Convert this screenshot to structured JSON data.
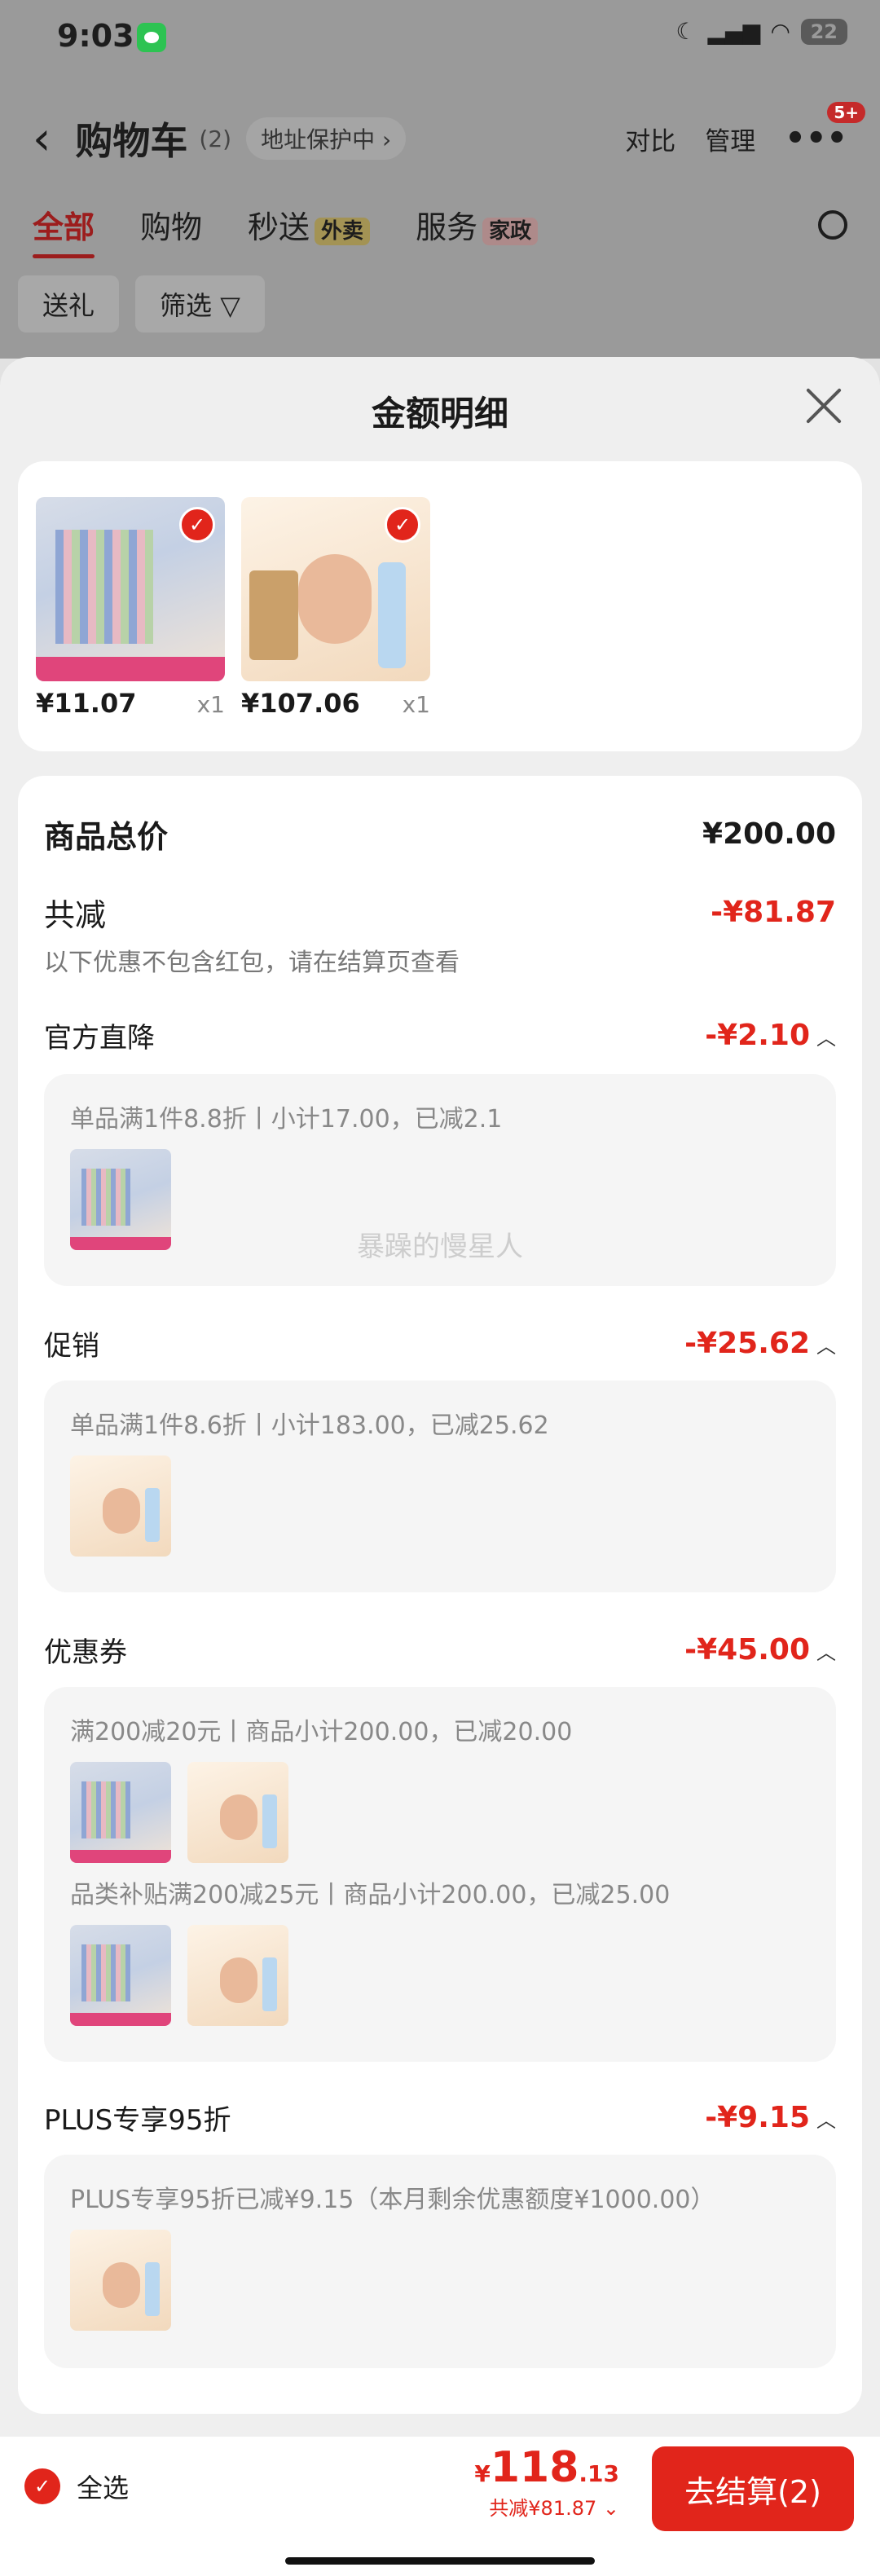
{
  "status": {
    "time": "9:03",
    "battery": "22"
  },
  "nav": {
    "back": "‹",
    "title": "购物车",
    "count": "(2)",
    "address": "地址保护中 ›",
    "compare": "对比",
    "manage": "管理",
    "more_badge": "5+"
  },
  "tabs": [
    "全部",
    "购物",
    "秒送",
    "服务"
  ],
  "tab_tags": {
    "miaosong": "外卖",
    "service": "家政"
  },
  "chips": [
    "送礼",
    "筛选 ▽"
  ],
  "sheet": {
    "title": "金额明细"
  },
  "products": [
    {
      "price": "¥11.07",
      "qty": "x1"
    },
    {
      "price": "¥107.06",
      "qty": "x1"
    }
  ],
  "summary": {
    "total_label": "商品总价",
    "total_value": "¥200.00",
    "reduce_label": "共减",
    "reduce_value": "-¥81.87",
    "note": "以下优惠不包含红包，请在结算页查看"
  },
  "sections": [
    {
      "title": "官方直降",
      "amount": "-¥2.10",
      "details": [
        "单品满1件8.8折丨小计17.00，已减2.1"
      ]
    },
    {
      "title": "促销",
      "amount": "-¥25.62",
      "details": [
        "单品满1件8.6折丨小计183.00，已减25.62"
      ]
    },
    {
      "title": "优惠券",
      "amount": "-¥45.00",
      "details": [
        "满200减20元丨商品小计200.00，已减20.00",
        "品类补贴满200减25元丨商品小计200.00，已减25.00"
      ]
    },
    {
      "title": "PLUS专享95折",
      "amount": "-¥9.15",
      "details": [
        "PLUS专享95折已减¥9.15（本月剩余优惠额度¥1000.00）"
      ]
    }
  ],
  "watermark": "暴躁的慢星人",
  "bottom": {
    "select_all": "全选",
    "currency": "¥",
    "total_int": "118",
    "total_dec": ".13",
    "reduce": "共减¥81.87 ⌄",
    "checkout": "去结算(2)"
  },
  "colors": {
    "accent": "#e1251b"
  }
}
